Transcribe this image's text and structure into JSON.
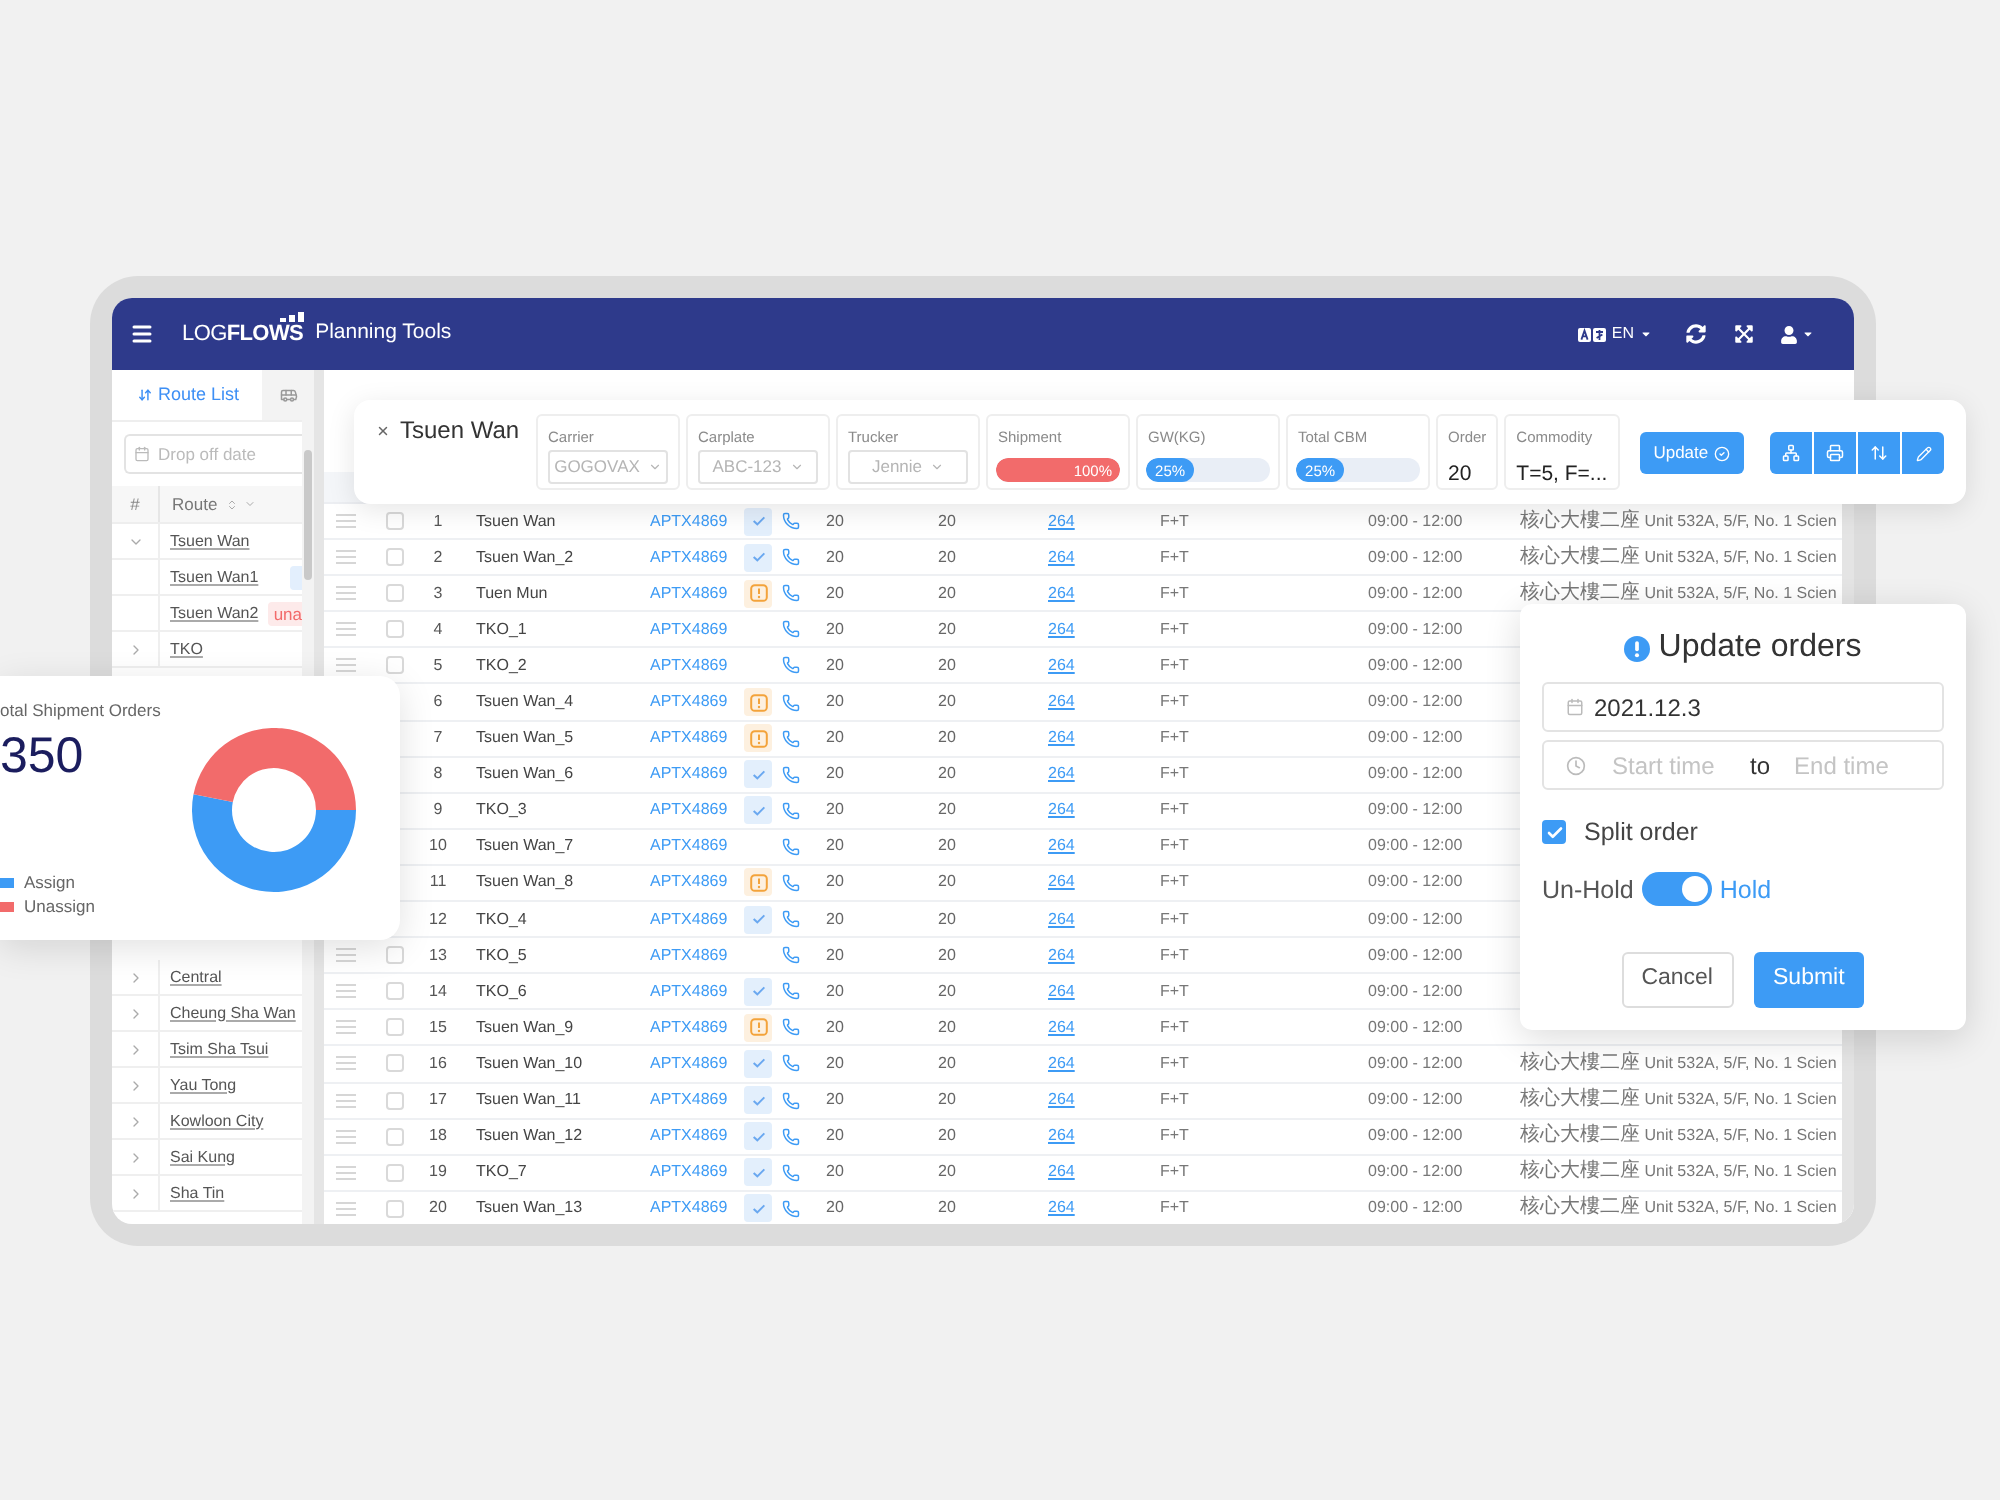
{
  "header": {
    "logo": "LOG**FLOWS**",
    "title": "Planning Tools",
    "language": "EN"
  },
  "sidebar": {
    "tabs": [
      {
        "label": "Route List",
        "selected": true
      },
      {
        "selected": false
      }
    ],
    "search": {
      "placeholder": "Drop off date"
    },
    "columns": [
      "#",
      "Route"
    ],
    "routes": [
      {
        "name": "Tsuen Wan",
        "expanded": true,
        "children": [
          {
            "name": "Tsuen Wan1",
            "tag": {
              "kind": "assign"
            }
          },
          {
            "name": "Tsuen Wan2",
            "tag": {
              "kind": "unassign",
              "text": "una"
            }
          }
        ]
      },
      {
        "name": "TKO",
        "expanded": false
      }
    ],
    "routes_continued": [
      {
        "name": "Central",
        "expanded": false
      },
      {
        "name": "Cheung Sha Wan",
        "expanded": false
      },
      {
        "name": "Tsim Sha Tsui",
        "expanded": false
      },
      {
        "name": "Yau Tong",
        "expanded": false
      },
      {
        "name": "Kowloon City",
        "expanded": false
      },
      {
        "name": "Sai Kung",
        "expanded": false
      },
      {
        "name": "Sha Tin",
        "expanded": false
      }
    ]
  },
  "route_card": {
    "title": "Tsuen Wan",
    "fields": [
      {
        "kind": "select",
        "label": "Carrier",
        "value": "GOGOVAX",
        "disabled": true
      },
      {
        "kind": "select",
        "label": "Carplate",
        "value": "ABC-123",
        "disabled": true
      },
      {
        "kind": "select",
        "label": "Trucker",
        "value": "Jennie",
        "disabled": true
      },
      {
        "kind": "progress",
        "label": "Shipment",
        "level": 1,
        "reading": "100%",
        "color": "#f26b6b"
      },
      {
        "kind": "progress",
        "label": "GW(KG)",
        "level": 0.38,
        "reading": "25%",
        "color": "#3d9bf5"
      },
      {
        "kind": "progress",
        "label": "Total CBM",
        "level": 0.38,
        "reading": "25%",
        "color": "#3d9bf5"
      },
      {
        "kind": "value",
        "label": "Order",
        "value": "20"
      },
      {
        "kind": "value",
        "label": "Commodity",
        "value": "T=5, F=..."
      }
    ],
    "update_button": "Update"
  },
  "orders_table": {
    "rows": [
      {
        "checked": false,
        "kind": "confirmed",
        "cells": [
          "1",
          "Tsuen Wan",
          "APTX4869",
          "20",
          "20",
          "264",
          "F+T",
          "09:00 - 12:00",
          "核心大樓二座 Unit 532A, 5/F, No. 1 Scien"
        ]
      },
      {
        "checked": false,
        "kind": "confirmed",
        "cells": [
          "2",
          "Tsuen Wan_2",
          "APTX4869",
          "20",
          "20",
          "264",
          "F+T",
          "09:00 - 12:00",
          "核心大樓二座 Unit 532A, 5/F, No. 1 Scien"
        ]
      },
      {
        "checked": false,
        "kind": "attention",
        "cells": [
          "3",
          "Tuen Mun",
          "APTX4869",
          "20",
          "20",
          "264",
          "F+T",
          "09:00 - 12:00",
          "核心大樓二座 Unit 532A, 5/F, No. 1 Scien"
        ]
      },
      {
        "checked": false,
        "kind": "plain",
        "cells": [
          "4",
          "TKO_1",
          "APTX4869",
          "20",
          "20",
          "264",
          "F+T",
          "09:00 - 12:00"
        ]
      },
      {
        "checked": false,
        "kind": "plain",
        "cells": [
          "5",
          "TKO_2",
          "APTX4869",
          "20",
          "20",
          "264",
          "F+T",
          "09:00 - 12:00"
        ]
      },
      {
        "kind": "attention",
        "cells": [
          "6",
          "Tsuen Wan_4",
          "APTX4869",
          "20",
          "20",
          "264",
          "F+T",
          "09:00 - 12:00"
        ]
      },
      {
        "kind": "attention",
        "cells": [
          "7",
          "Tsuen Wan_5",
          "APTX4869",
          "20",
          "20",
          "264",
          "F+T",
          "09:00 - 12:00"
        ]
      },
      {
        "kind": "confirmed",
        "cells": [
          "8",
          "Tsuen Wan_6",
          "APTX4869",
          "20",
          "20",
          "264",
          "F+T",
          "09:00 - 12:00"
        ]
      },
      {
        "kind": "confirmed",
        "cells": [
          "9",
          "TKO_3",
          "APTX4869",
          "20",
          "20",
          "264",
          "F+T",
          "09:00 - 12:00"
        ]
      },
      {
        "kind": "plain",
        "cells": [
          "10",
          "Tsuen Wan_7",
          "APTX4869",
          "20",
          "20",
          "264",
          "F+T",
          "09:00 - 12:00"
        ]
      },
      {
        "kind": "attention",
        "cells": [
          "11",
          "Tsuen Wan_8",
          "APTX4869",
          "20",
          "20",
          "264",
          "F+T",
          "09:00 - 12:00"
        ]
      },
      {
        "kind": "confirmed",
        "cells": [
          "12",
          "TKO_4",
          "APTX4869",
          "20",
          "20",
          "264",
          "F+T",
          "09:00 - 12:00"
        ]
      },
      {
        "checked": false,
        "kind": "plain",
        "cells": [
          "13",
          "TKO_5",
          "APTX4869",
          "20",
          "20",
          "264",
          "F+T",
          "09:00 - 12:00"
        ]
      },
      {
        "checked": false,
        "kind": "confirmed",
        "cells": [
          "14",
          "TKO_6",
          "APTX4869",
          "20",
          "20",
          "264",
          "F+T",
          "09:00 - 12:00"
        ]
      },
      {
        "checked": false,
        "kind": "attention",
        "cells": [
          "15",
          "Tsuen Wan_9",
          "APTX4869",
          "20",
          "20",
          "264",
          "F+T",
          "09:00 - 12:00"
        ]
      },
      {
        "checked": false,
        "kind": "confirmed",
        "cells": [
          "16",
          "Tsuen Wan_10",
          "APTX4869",
          "20",
          "20",
          "264",
          "F+T",
          "09:00 - 12:00",
          "核心大樓二座 Unit 532A, 5/F, No. 1 Scien"
        ]
      },
      {
        "checked": false,
        "kind": "confirmed",
        "cells": [
          "17",
          "Tsuen Wan_11",
          "APTX4869",
          "20",
          "20",
          "264",
          "F+T",
          "09:00 - 12:00",
          "核心大樓二座 Unit 532A, 5/F, No. 1 Scien"
        ]
      },
      {
        "checked": false,
        "kind": "confirmed",
        "cells": [
          "18",
          "Tsuen Wan_12",
          "APTX4869",
          "20",
          "20",
          "264",
          "F+T",
          "09:00 - 12:00",
          "核心大樓二座 Unit 532A, 5/F, No. 1 Scien"
        ]
      },
      {
        "checked": false,
        "kind": "confirmed",
        "cells": [
          "19",
          "TKO_7",
          "APTX4869",
          "20",
          "20",
          "264",
          "F+T",
          "09:00 - 12:00",
          "核心大樓二座 Unit 532A, 5/F, No. 1 Scien"
        ]
      },
      {
        "checked": false,
        "kind": "confirmed",
        "cells": [
          "20",
          "Tsuen Wan_13",
          "APTX4869",
          "20",
          "20",
          "264",
          "F+T",
          "09:00 - 12:00",
          "核心大樓二座 Unit 532A, 5/F, No. 1 Scien"
        ]
      }
    ]
  },
  "orders_summary": {
    "title": "otal Shipment Orders",
    "total": "350",
    "legend": [
      {
        "label": "Assign",
        "color": "#3d9bf5"
      },
      {
        "label": "Unassign",
        "color": "#f26b6b"
      }
    ]
  },
  "dialog": {
    "title": "Update orders",
    "date": {
      "value": "2021.12.3"
    },
    "time_range": {
      "start_placeholder": "Start time",
      "separator": "to",
      "end_placeholder": "End time"
    },
    "split_order": {
      "label": "Split order",
      "checked": true
    },
    "hold": {
      "off_label": "Un-Hold",
      "on_label": "Hold",
      "on": true
    },
    "buttons": [
      {
        "label": "Cancel",
        "kind": "secondary"
      },
      {
        "label": "Submit",
        "kind": "primary"
      }
    ]
  }
}
